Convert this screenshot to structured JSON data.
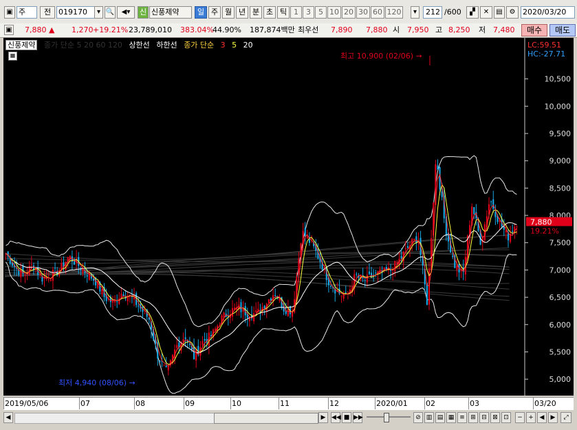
{
  "toolbar": {
    "market": "주",
    "prev_label": "전",
    "code": "019170",
    "stock_tag": "신",
    "stock_name": "신풍제약",
    "periods": [
      "일",
      "주",
      "월",
      "년",
      "분",
      "초",
      "틱"
    ],
    "selected_period": "일",
    "intervals": [
      "1",
      "3",
      "5",
      "10",
      "20",
      "30",
      "60",
      "120"
    ],
    "count": "212",
    "total": "/600",
    "date": "2020/03/20"
  },
  "quote": {
    "price": "7,880",
    "arrow": "▲",
    "change": "1,270",
    "rate": "+19.21%",
    "volume": "23,789,010",
    "vol_ratio": "383.04%",
    "turnover": "44.90%",
    "amount": "187,874백만",
    "best_ask_label": "최우선",
    "ask": "7,890",
    "bid": "7,880",
    "open_label": "시",
    "open": "7,950",
    "high_label": "고",
    "high": "8,250",
    "low_label": "저",
    "low": "7,480",
    "buy_label": "매수",
    "sell_label": "매도"
  },
  "legend": {
    "name": "신풍제약",
    "hidden_ma": "종가 단순 5 20 60 120",
    "upper": "상한선",
    "lower": "하한선",
    "ma_label": "종가 단순",
    "ma_periods": [
      "3",
      "5",
      "20"
    ]
  },
  "annotations": {
    "max": "최고 10,900 (02/06)",
    "min": "최저 4,940 (08/06)",
    "lc": "LC:59.51",
    "hc": "HC:-27.71",
    "cur_price": "7,880",
    "cur_rate": "19.21%"
  },
  "colors": {
    "up": "#e0001a",
    "down": "#17a8e6",
    "ma3": "#ff3030",
    "ma5": "#ffff40",
    "ma20": "#ffffff"
  },
  "chart_data": {
    "type": "candlestick",
    "ylim": [
      4800,
      11000
    ],
    "yticks": [
      5000,
      5500,
      6000,
      6500,
      7000,
      7500,
      8000,
      8500,
      9000,
      9500,
      10000,
      10500
    ],
    "ytick_labels": [
      "5,000",
      "5,500",
      "6,000",
      "6,500",
      "7,000",
      "7,500",
      "8,000",
      "8,500",
      "9,000",
      "9,500",
      "10,000",
      "10,500"
    ],
    "xticks": [
      "2019/05/06",
      "07",
      "08",
      "09",
      "10",
      "11",
      "12",
      "2020/01",
      "02",
      "03",
      "03/20"
    ],
    "close_series": [
      7300,
      7050,
      6900,
      7100,
      6850,
      6900,
      7000,
      7250,
      7100,
      6950,
      6800,
      6500,
      6400,
      6600,
      6500,
      6300,
      6100,
      5400,
      5100,
      5600,
      5800,
      5400,
      5700,
      5800,
      6100,
      6250,
      6300,
      6200,
      6200,
      6400,
      6600,
      6300,
      6250,
      7700,
      7500,
      7200,
      6800,
      6600,
      6500,
      6900,
      6800,
      6900,
      6950,
      7000,
      7200,
      7450,
      7600,
      6400,
      9100,
      7800,
      7100,
      6900,
      8200,
      7500,
      8300,
      7900,
      7600,
      7880
    ]
  },
  "scrollbar": {
    "zoom_out": "−",
    "zoom_in": "+",
    "reset": "⊘"
  }
}
